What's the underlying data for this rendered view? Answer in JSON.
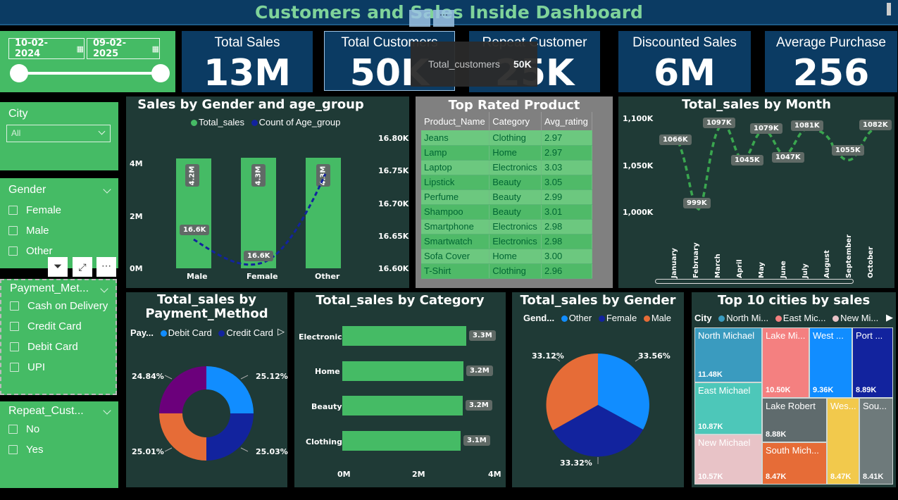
{
  "header": {
    "title": "Customers and Sales Inside Dashboard"
  },
  "dates": {
    "start": "10-02-2024",
    "end": "09-02-2025"
  },
  "kpis": [
    {
      "label": "Total Sales",
      "value": "13M"
    },
    {
      "label": "Total Customers",
      "value": "50K"
    },
    {
      "label": "Repeat Customer",
      "value": "25K"
    },
    {
      "label": "Discounted Sales",
      "value": "6M"
    },
    {
      "label": "Average Purchase",
      "value": "256"
    }
  ],
  "tooltip": {
    "label": "Total_customers",
    "value": "50K"
  },
  "slicers": {
    "city": {
      "title": "City",
      "selected": "All"
    },
    "gender": {
      "title": "Gender",
      "options": [
        "Female",
        "Male",
        "Other"
      ]
    },
    "payment": {
      "title": "Payment_Met...",
      "options": [
        "Cash on Delivery",
        "Credit Card",
        "Debit Card",
        "UPI"
      ]
    },
    "repeat": {
      "title": "Repeat_Cust...",
      "options": [
        "No",
        "Yes"
      ]
    }
  },
  "charts": {
    "gender_age": {
      "title": "Sales by Gender and age_group",
      "legend": [
        "Total_sales",
        "Count of Age_group"
      ],
      "categories": [
        "Male",
        "Female",
        "Other"
      ],
      "bar_labels": [
        "4.2M",
        "4.3M",
        "4.3M"
      ],
      "line_labels": [
        "16.6K",
        "16.6K"
      ],
      "left_ticks": [
        "4M",
        "2M",
        "0M"
      ],
      "right_ticks": [
        "16.80K",
        "16.75K",
        "16.70K",
        "16.65K",
        "16.60K"
      ]
    },
    "top_rated": {
      "title": "Top Rated Product",
      "columns": [
        "Product_Name",
        "Category",
        "Avg_rating"
      ],
      "rows": [
        [
          "Jeans",
          "Clothing",
          "2.97"
        ],
        [
          "Lamp",
          "Home",
          "2.97"
        ],
        [
          "Laptop",
          "Electronics",
          "3.03"
        ],
        [
          "Lipstick",
          "Beauty",
          "3.05"
        ],
        [
          "Perfume",
          "Beauty",
          "2.99"
        ],
        [
          "Shampoo",
          "Beauty",
          "3.01"
        ],
        [
          "Smartphone",
          "Electronics",
          "2.98"
        ],
        [
          "Smartwatch",
          "Electronics",
          "2.98"
        ],
        [
          "Sofa Cover",
          "Home",
          "3.00"
        ],
        [
          "T-Shirt",
          "Clothing",
          "2.96"
        ]
      ]
    },
    "by_month": {
      "title": "Total_sales by Month",
      "y_ticks": [
        "1,100K",
        "1,050K",
        "1,000K"
      ],
      "months": [
        "January",
        "February",
        "March",
        "April",
        "May",
        "June",
        "July",
        "August",
        "September",
        "October"
      ],
      "labels": [
        "1066K",
        "999K",
        "1097K",
        "1045K",
        "1079K",
        "1047K",
        "1081K",
        "1055K",
        "1082K"
      ]
    },
    "payment": {
      "title_lines": [
        "Total_sales by",
        "Payment_Method"
      ],
      "legend_title": "Pay...",
      "legend": [
        "Debit Card",
        "Credit Card"
      ],
      "labels": [
        "25.12%",
        "25.03%",
        "25.01%",
        "24.84%"
      ]
    },
    "category": {
      "title": "Total_sales by Category",
      "categories": [
        "Electronics",
        "Home",
        "Beauty",
        "Clothing"
      ],
      "labels": [
        "3.3M",
        "3.2M",
        "3.2M",
        "3.1M"
      ],
      "x_ticks": [
        "0M",
        "2M",
        "4M"
      ]
    },
    "gender": {
      "title": "Total_sales by Gender",
      "legend_title": "Gend...",
      "legend": [
        "Other",
        "Female",
        "Male"
      ],
      "labels": [
        "33.56%",
        "33.32%",
        "33.12%"
      ]
    },
    "cities": {
      "title": "Top 10 cities by sales",
      "legend_title": "City",
      "legend": [
        "North Mi...",
        "East Mic...",
        "New Mi..."
      ],
      "tiles": [
        {
          "name": "North Michael",
          "value": "11.48K"
        },
        {
          "name": "Lake Mi...",
          "value": "10.50K"
        },
        {
          "name": "West ...",
          "value": "9.36K"
        },
        {
          "name": "Port ...",
          "value": "8.89K"
        },
        {
          "name": "East Michael",
          "value": "10.87K"
        },
        {
          "name": "Lake Robert",
          "value": "8.88K"
        },
        {
          "name": "New Michael",
          "value": "10.57K"
        },
        {
          "name": "South Mich...",
          "value": "8.47K"
        },
        {
          "name": "Wes...",
          "value": "8.47K"
        },
        {
          "name": "Sou...",
          "value": "8.41K"
        }
      ]
    }
  },
  "chart_data": [
    {
      "type": "bar",
      "title": "Sales by Gender and age_group",
      "categories": [
        "Male",
        "Female",
        "Other"
      ],
      "series": [
        {
          "name": "Total_sales",
          "values": [
            4.2,
            4.3,
            4.3
          ]
        },
        {
          "name": "Count of Age_group",
          "values": [
            16.6,
            16.6,
            16.78
          ]
        }
      ]
    },
    {
      "type": "line",
      "title": "Total_sales by Month",
      "x": [
        "January",
        "February",
        "March",
        "April",
        "May",
        "June",
        "July",
        "August",
        "September",
        "October"
      ],
      "series": [
        {
          "values": [
            1066,
            999,
            1097,
            1045,
            1079,
            1047,
            1081,
            1080,
            1055,
            1082
          ]
        }
      ],
      "ylim": [
        990,
        1110
      ]
    },
    {
      "type": "pie",
      "title": "Total_sales by Payment_Method",
      "values": [
        25.12,
        25.03,
        25.01,
        24.84
      ]
    },
    {
      "type": "bar",
      "title": "Total_sales by Category",
      "categories": [
        "Electronics",
        "Home",
        "Beauty",
        "Clothing"
      ],
      "values": [
        3.3,
        3.2,
        3.2,
        3.1
      ],
      "xlim": [
        0,
        4
      ]
    },
    {
      "type": "pie",
      "title": "Total_sales by Gender",
      "categories": [
        "Other",
        "Female",
        "Male"
      ],
      "values": [
        33.56,
        33.32,
        33.12
      ]
    }
  ],
  "colors": {
    "green": "#45bb65",
    "navy": "#0b3b63",
    "panel": "#1f3a36",
    "blue": "#118dff",
    "darkblue": "#12239e",
    "orange": "#e66c37",
    "purple": "#6b007b"
  }
}
